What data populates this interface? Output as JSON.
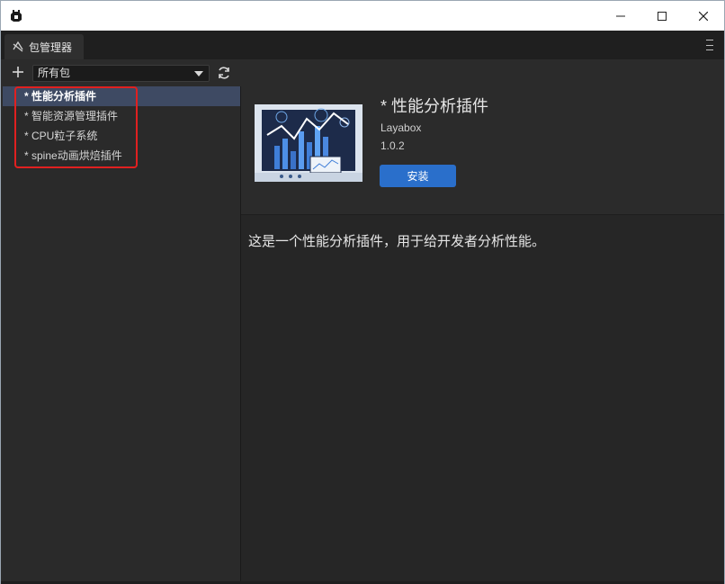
{
  "window": {
    "controls": {
      "minimize": "minimize-icon",
      "maximize": "maximize-icon",
      "close": "close-icon"
    }
  },
  "tab": {
    "label": "包管理器",
    "icon": "package-icon"
  },
  "toolbar": {
    "filter_selected": "所有包",
    "add_icon": "plus-icon",
    "refresh_icon": "refresh-icon"
  },
  "packages": [
    {
      "label": "* 性能分析插件",
      "selected": true
    },
    {
      "label": "* 智能资源管理插件",
      "selected": false
    },
    {
      "label": "* CPU粒子系统",
      "selected": false
    },
    {
      "label": "* spine动画烘焙插件",
      "selected": false
    }
  ],
  "detail": {
    "title": "* 性能分析插件",
    "author": "Layabox",
    "version": "1.0.2",
    "install_label": "安装",
    "description": "这是一个性能分析插件，用于给开发者分析性能。"
  },
  "colors": {
    "accent": "#2a6fcb",
    "selection": "#3e4a63",
    "highlight": "#e02020"
  }
}
